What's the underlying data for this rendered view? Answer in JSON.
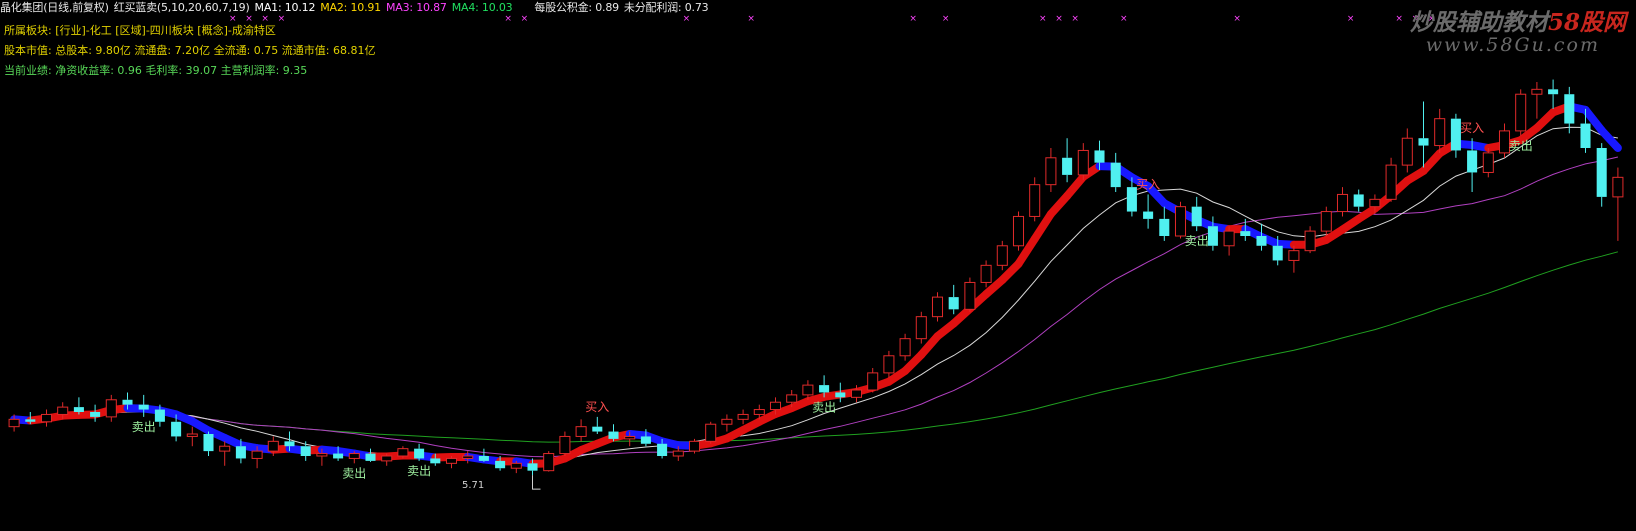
{
  "header": {
    "stock_name": "晶化集团(日线,前复权)",
    "indicator": "红买蓝卖(5,10,20,60,7,19)",
    "ma1": "MA1: 10.12",
    "ma2": "MA2: 10.91",
    "ma3": "MA3: 10.87",
    "ma4": "MA4: 10.03",
    "reserve": "每股公积金: 0.89",
    "undistributed": "未分配利润: 0.73"
  },
  "info": {
    "sector": "所属板块: [行业]-化工 [区域]-四川板块 [概念]-成渝特区",
    "capital": "股本市值: 总股本: 9.80亿 流通盘: 7.20亿 全流通: 0.75 流通市值: 68.81亿",
    "performance": "当前业绩: 净资收益率: 0.96 毛利率: 39.07 主营利润率: 9.35"
  },
  "watermark": {
    "title_grey": "炒股辅助教材",
    "title_red": "58股网",
    "url": "www.58Gu.com"
  },
  "low_marker": "5.71",
  "colors": {
    "header_name": "#e8e8e8",
    "header_indicator": "#e8e8e8",
    "ma1": "#ffffff",
    "ma2": "#ffd700",
    "ma3": "#ff44ff",
    "ma4": "#20e060",
    "info_text": "#e0d000",
    "info_perf": "#58d858",
    "up_candle": "#e02a2a",
    "down_candle": "#50f0f0",
    "buy_line": "#e01010",
    "sell_line": "#1818ff",
    "ma20_line": "#b040c0",
    "ma60_line": "#20a020",
    "signal_mark": "#ff44ff"
  },
  "chart_data": {
    "type": "candlestick",
    "ohlc": [
      [
        6.7,
        6.95,
        6.6,
        6.85
      ],
      [
        6.85,
        7.0,
        6.75,
        6.8
      ],
      [
        6.8,
        7.05,
        6.7,
        6.95
      ],
      [
        6.95,
        7.2,
        6.85,
        7.1
      ],
      [
        7.1,
        7.3,
        6.95,
        7.0
      ],
      [
        7.0,
        7.15,
        6.8,
        6.9
      ],
      [
        6.9,
        7.35,
        6.8,
        7.25
      ],
      [
        7.25,
        7.4,
        7.05,
        7.15
      ],
      [
        7.15,
        7.35,
        6.9,
        7.05
      ],
      [
        7.05,
        7.15,
        6.7,
        6.8
      ],
      [
        6.8,
        6.95,
        6.4,
        6.5
      ],
      [
        6.5,
        6.7,
        6.3,
        6.55
      ],
      [
        6.55,
        6.6,
        6.1,
        6.2
      ],
      [
        6.2,
        6.4,
        5.9,
        6.3
      ],
      [
        6.3,
        6.45,
        5.95,
        6.05
      ],
      [
        6.05,
        6.3,
        5.85,
        6.2
      ],
      [
        6.2,
        6.5,
        6.1,
        6.4
      ],
      [
        6.4,
        6.6,
        6.2,
        6.3
      ],
      [
        6.3,
        6.4,
        6.0,
        6.1
      ],
      [
        6.1,
        6.25,
        5.9,
        6.15
      ],
      [
        6.15,
        6.3,
        6.0,
        6.05
      ],
      [
        6.05,
        6.2,
        5.95,
        6.15
      ],
      [
        6.15,
        6.25,
        5.98,
        6.0
      ],
      [
        6.0,
        6.15,
        5.9,
        6.1
      ],
      [
        6.1,
        6.3,
        6.05,
        6.25
      ],
      [
        6.25,
        6.35,
        6.0,
        6.05
      ],
      [
        6.05,
        6.15,
        5.9,
        5.95
      ],
      [
        5.95,
        6.1,
        5.85,
        6.05
      ],
      [
        6.05,
        6.2,
        5.95,
        6.1
      ],
      [
        6.1,
        6.25,
        5.98,
        6.0
      ],
      [
        6.0,
        6.1,
        5.8,
        5.85
      ],
      [
        5.85,
        6.0,
        5.75,
        5.95
      ],
      [
        5.95,
        6.05,
        5.71,
        5.8
      ],
      [
        5.8,
        6.2,
        5.78,
        6.15
      ],
      [
        6.15,
        6.6,
        6.1,
        6.5
      ],
      [
        6.5,
        6.85,
        6.4,
        6.7
      ],
      [
        6.7,
        6.9,
        6.55,
        6.6
      ],
      [
        6.6,
        6.75,
        6.4,
        6.45
      ],
      [
        6.45,
        6.6,
        6.3,
        6.5
      ],
      [
        6.5,
        6.65,
        6.3,
        6.35
      ],
      [
        6.35,
        6.45,
        6.05,
        6.1
      ],
      [
        6.1,
        6.3,
        6.0,
        6.2
      ],
      [
        6.2,
        6.45,
        6.15,
        6.4
      ],
      [
        6.4,
        6.8,
        6.35,
        6.75
      ],
      [
        6.75,
        6.95,
        6.6,
        6.85
      ],
      [
        6.85,
        7.05,
        6.75,
        6.95
      ],
      [
        6.95,
        7.15,
        6.85,
        7.05
      ],
      [
        7.05,
        7.3,
        6.95,
        7.2
      ],
      [
        7.2,
        7.45,
        7.1,
        7.35
      ],
      [
        7.35,
        7.65,
        7.25,
        7.55
      ],
      [
        7.55,
        7.75,
        7.3,
        7.4
      ],
      [
        7.4,
        7.6,
        7.2,
        7.3
      ],
      [
        7.3,
        7.55,
        7.2,
        7.45
      ],
      [
        7.45,
        7.9,
        7.4,
        7.8
      ],
      [
        7.8,
        8.25,
        7.7,
        8.15
      ],
      [
        8.15,
        8.6,
        8.05,
        8.5
      ],
      [
        8.5,
        9.05,
        8.4,
        8.95
      ],
      [
        8.95,
        9.45,
        8.85,
        9.35
      ],
      [
        9.35,
        9.6,
        9.0,
        9.1
      ],
      [
        9.1,
        9.75,
        9.05,
        9.65
      ],
      [
        9.65,
        10.1,
        9.55,
        10.0
      ],
      [
        10.0,
        10.5,
        9.9,
        10.4
      ],
      [
        10.4,
        11.1,
        10.3,
        11.0
      ],
      [
        11.0,
        11.8,
        10.9,
        11.65
      ],
      [
        11.65,
        12.4,
        11.5,
        12.2
      ],
      [
        12.2,
        12.6,
        11.7,
        11.85
      ],
      [
        11.85,
        12.5,
        11.75,
        12.35
      ],
      [
        12.35,
        12.55,
        11.95,
        12.1
      ],
      [
        12.1,
        12.3,
        11.5,
        11.6
      ],
      [
        11.6,
        11.8,
        11.0,
        11.1
      ],
      [
        11.1,
        11.45,
        10.75,
        10.95
      ],
      [
        10.95,
        11.2,
        10.5,
        10.6
      ],
      [
        10.6,
        11.3,
        10.55,
        11.2
      ],
      [
        11.2,
        11.4,
        10.7,
        10.8
      ],
      [
        10.8,
        11.0,
        10.3,
        10.4
      ],
      [
        10.4,
        10.8,
        10.2,
        10.7
      ],
      [
        10.7,
        10.95,
        10.5,
        10.6
      ],
      [
        10.6,
        10.85,
        10.3,
        10.4
      ],
      [
        10.4,
        10.6,
        10.0,
        10.1
      ],
      [
        10.1,
        10.4,
        9.85,
        10.3
      ],
      [
        10.3,
        10.8,
        10.25,
        10.7
      ],
      [
        10.7,
        11.2,
        10.6,
        11.1
      ],
      [
        11.1,
        11.6,
        11.0,
        11.45
      ],
      [
        11.45,
        11.55,
        11.1,
        11.2
      ],
      [
        11.2,
        11.45,
        11.05,
        11.35
      ],
      [
        11.35,
        12.2,
        11.3,
        12.05
      ],
      [
        12.05,
        12.8,
        11.9,
        12.6
      ],
      [
        12.6,
        13.35,
        12.0,
        12.45
      ],
      [
        12.45,
        13.2,
        12.3,
        13.0
      ],
      [
        13.0,
        13.1,
        12.2,
        12.35
      ],
      [
        12.35,
        12.6,
        11.5,
        11.9
      ],
      [
        11.9,
        12.4,
        11.8,
        12.3
      ],
      [
        12.3,
        12.9,
        12.2,
        12.75
      ],
      [
        12.75,
        13.6,
        12.65,
        13.5
      ],
      [
        13.5,
        13.75,
        13.0,
        13.6
      ],
      [
        13.6,
        13.8,
        13.2,
        13.5
      ],
      [
        13.5,
        13.65,
        12.7,
        12.9
      ],
      [
        12.9,
        13.2,
        12.3,
        12.4
      ],
      [
        12.4,
        12.5,
        11.2,
        11.4
      ],
      [
        11.4,
        12.0,
        10.5,
        11.8
      ]
    ],
    "ma_params": [
      5,
      10,
      20,
      60
    ],
    "signals": [
      {
        "label": "卖出",
        "index": 8
      },
      {
        "label": "卖出",
        "index": 21
      },
      {
        "label": "卖出",
        "index": 25
      },
      {
        "label": "买入",
        "index": 36
      },
      {
        "label": "卖出",
        "index": 50
      },
      {
        "label": "买入",
        "index": 70
      },
      {
        "label": "卖出",
        "index": 73
      },
      {
        "label": "买入",
        "index": 90
      },
      {
        "label": "卖出",
        "index": 93
      }
    ],
    "low": {
      "label": "5.71",
      "value": 5.71
    },
    "ylim": [
      5.2,
      14.2
    ],
    "grid": false
  }
}
